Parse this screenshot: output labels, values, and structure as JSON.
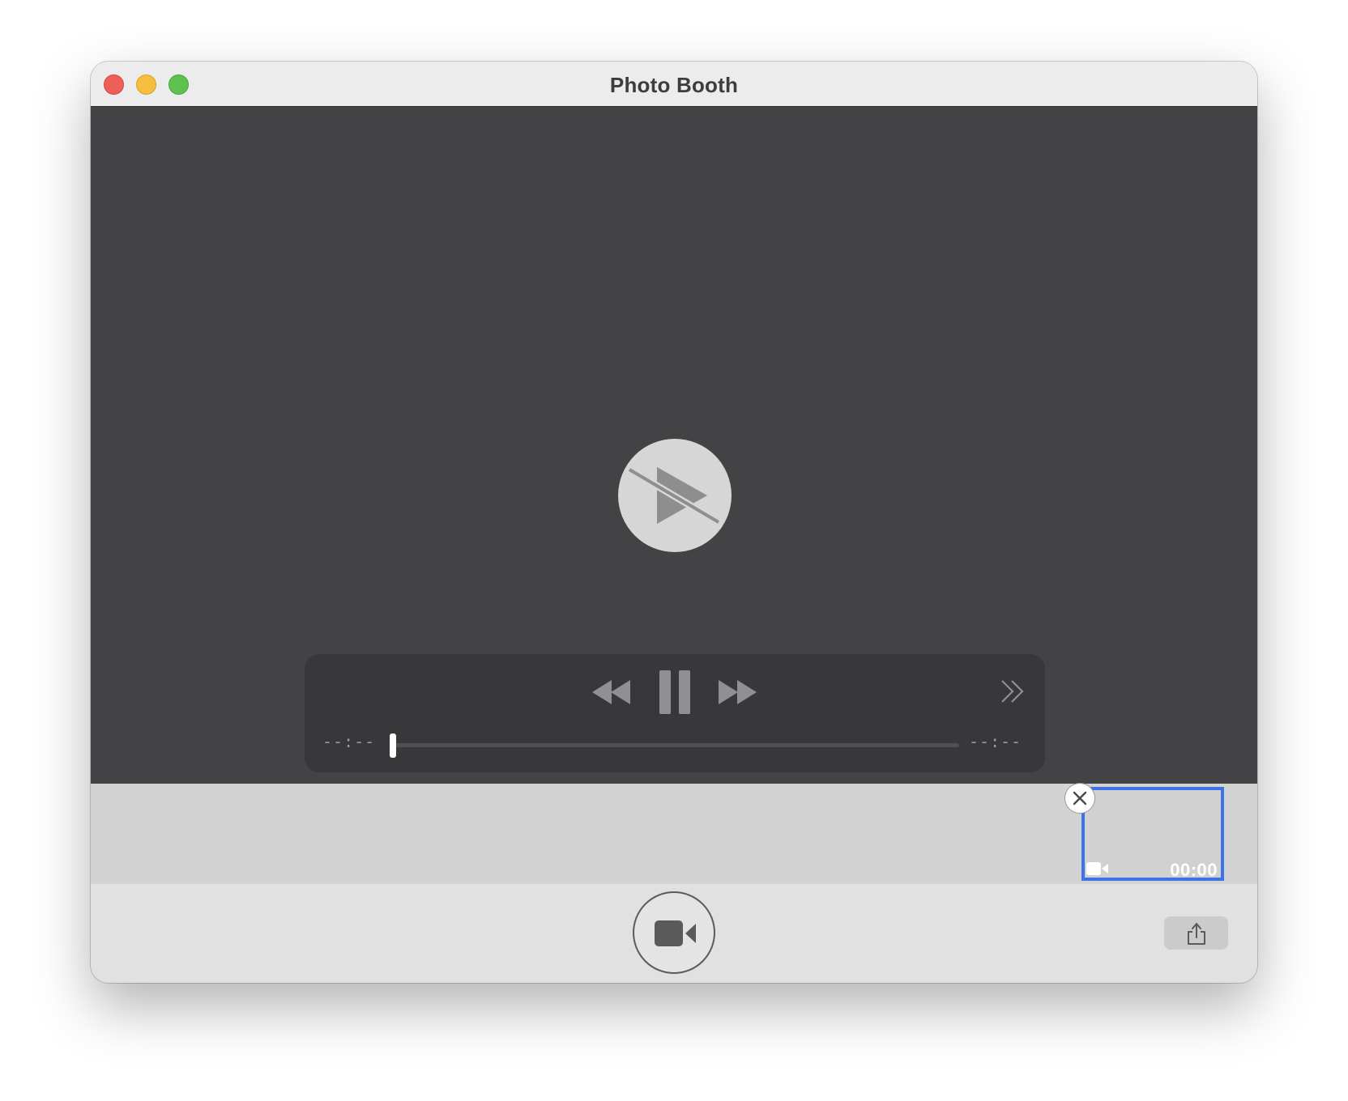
{
  "window": {
    "title": "Photo Booth"
  },
  "player": {
    "elapsed_time": "--:--",
    "remaining_time": "--:--",
    "playback_progress": 0
  },
  "thumbnails": [
    {
      "kind": "video",
      "duration": "00:00",
      "selected": true
    }
  ],
  "icons": {
    "big_play": "play-disabled-icon",
    "rewind": "rewind-icon",
    "pause": "pause-icon",
    "fast_forward": "fast-forward-icon",
    "more": "chevron-double-right-icon",
    "delete": "close-icon",
    "thumbnail_type": "video-camera-icon",
    "record": "video-camera-icon",
    "share": "share-icon"
  },
  "colors": {
    "selection": "#3d73e6",
    "close": "#ee5f58",
    "minimize": "#f7bd3d",
    "maximize": "#5fc24f"
  }
}
